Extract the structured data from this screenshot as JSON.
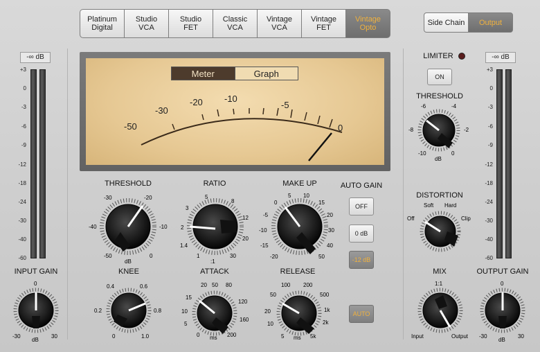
{
  "models": [
    {
      "label": "Platinum\nDigital",
      "active": false
    },
    {
      "label": "Studio\nVCA",
      "active": false
    },
    {
      "label": "Studio\nFET",
      "active": false
    },
    {
      "label": "Classic\nVCA",
      "active": false
    },
    {
      "label": "Vintage\nVCA",
      "active": false
    },
    {
      "label": "Vintage\nFET",
      "active": false
    },
    {
      "label": "Vintage\nOpto",
      "active": true
    }
  ],
  "side_chain": {
    "side_label": "Side Chain",
    "output_label": "Output",
    "selected": "Output"
  },
  "input_meter": {
    "readout": "-∞ dB",
    "scale": [
      "+3",
      "0",
      "-3",
      "-6",
      "-9",
      "-12",
      "-18",
      "-24",
      "-30",
      "-40",
      "-60"
    ]
  },
  "output_meter": {
    "readout": "-∞ dB",
    "scale": [
      "+3",
      "0",
      "-3",
      "-6",
      "-9",
      "-12",
      "-18",
      "-24",
      "-30",
      "-40",
      "-60"
    ]
  },
  "vu": {
    "mode_meter": "Meter",
    "mode_graph": "Graph",
    "selected": "Meter",
    "scale": [
      "-50",
      "-30",
      "-20",
      "-10",
      "-5",
      "0"
    ]
  },
  "knobs": {
    "threshold": {
      "label": "THRESHOLD",
      "ticks": [
        "-30",
        "-20",
        "-40",
        "-10",
        "-50",
        "0"
      ],
      "unit": "dB"
    },
    "ratio": {
      "label": "RATIO",
      "ticks": [
        "5",
        "8",
        "3",
        "12",
        "2",
        "20",
        "1.4",
        "30",
        "1",
        ":1"
      ]
    },
    "makeup": {
      "label": "MAKE UP",
      "ticks": [
        "0",
        "5",
        "10",
        "15",
        "-5",
        "20",
        "-10",
        "30",
        "-15",
        "40",
        "-20",
        "50"
      ]
    },
    "knee": {
      "label": "KNEE",
      "ticks": [
        "0.4",
        "0.6",
        "0.2",
        "0.8",
        "0",
        "1.0"
      ]
    },
    "attack": {
      "label": "ATTACK",
      "ticks": [
        "20",
        "50",
        "80",
        "15",
        "120",
        "10",
        "160",
        "5",
        "200",
        "0",
        "ms"
      ]
    },
    "release": {
      "label": "RELEASE",
      "ticks": [
        "100",
        "200",
        "50",
        "500",
        "20",
        "1k",
        "10",
        "2k",
        "5",
        "5k",
        "ms"
      ]
    },
    "input_gain": {
      "label": "INPUT GAIN",
      "ticks": [
        "0",
        "-30",
        "30"
      ],
      "unit": "dB"
    },
    "output_gain": {
      "label": "OUTPUT GAIN",
      "ticks": [
        "0",
        "-30",
        "30"
      ],
      "unit": "dB"
    },
    "limiter_threshold": {
      "label": "THRESHOLD",
      "ticks": [
        "-6",
        "-4",
        "-8",
        "-2",
        "-10",
        "0"
      ],
      "unit": "dB"
    },
    "distortion": {
      "label": "DISTORTION",
      "ticks": [
        "Soft",
        "Hard",
        "Off",
        "Clip"
      ]
    },
    "mix": {
      "label": "MIX",
      "ticks": [
        "1:1",
        "Input",
        "Output"
      ]
    }
  },
  "auto_gain": {
    "label": "AUTO GAIN",
    "options": [
      "OFF",
      "0 dB",
      "-12 dB"
    ],
    "selected": "-12 dB"
  },
  "auto_button": {
    "label": "AUTO",
    "active": true
  },
  "limiter": {
    "label": "LIMITER",
    "on_label": "ON",
    "led_color": "#5a1d1d"
  },
  "colors": {
    "accent": "#f0b13d",
    "active_bg": "#7e7e7e"
  }
}
